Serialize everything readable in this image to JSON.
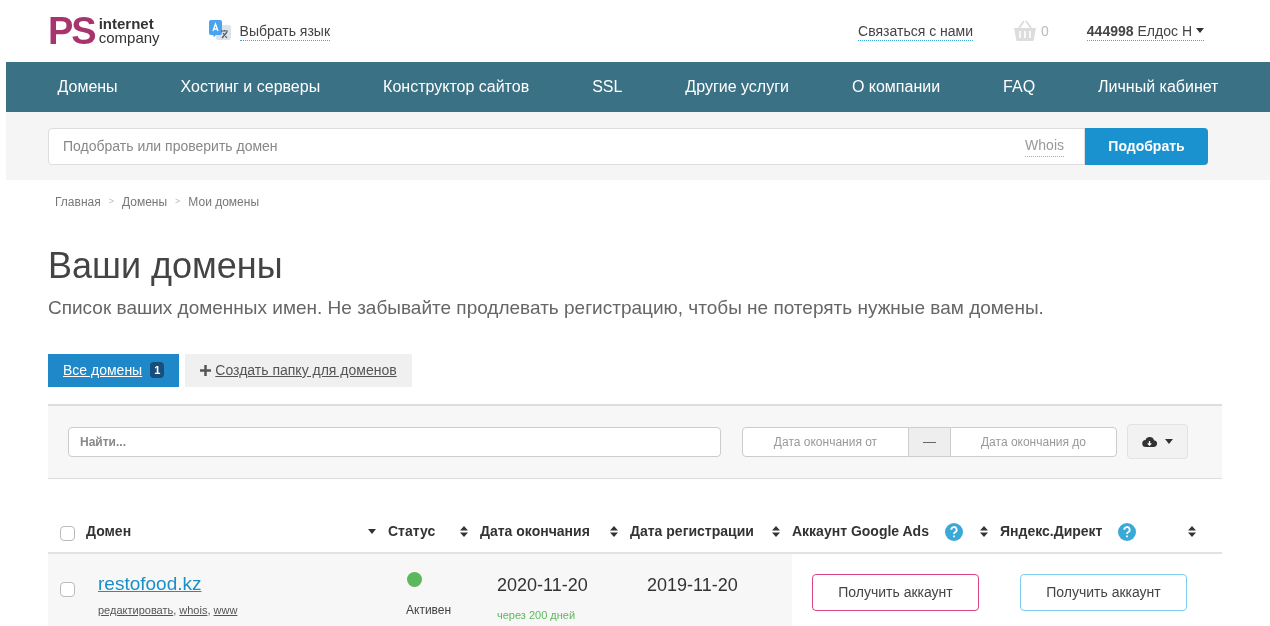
{
  "header": {
    "logo": {
      "mark": "PS",
      "line1": "internet",
      "line2": "company"
    },
    "language": "Выбрать язык",
    "contact": "Связаться с нами",
    "cart_count": "0",
    "account_id": "444998",
    "account_name": "Елдос Н"
  },
  "nav": [
    "Домены",
    "Хостинг и серверы",
    "Конструктор сайтов",
    "SSL",
    "Другие услуги",
    "О компании",
    "FAQ",
    "Личный кабинет"
  ],
  "domain_search": {
    "placeholder": "Подобрать или проверить домен",
    "whois": "Whois",
    "button": "Подобрать"
  },
  "breadcrumbs": [
    {
      "label": "Главная"
    },
    {
      "separator": ">",
      "label": "Домены"
    },
    {
      "separator": ">",
      "label": "Мои домены"
    }
  ],
  "title": "Ваши домены",
  "subtitle": "Список ваших доменных имен. Не забывайте продлевать регистрацию, чтобы не потерять нужные вам домены.",
  "tabs": [
    {
      "label": "Все домены",
      "count": "1",
      "selected": true,
      "kind": "folder"
    },
    {
      "label": "Создать папку для доменов",
      "selected": false,
      "kind": "create"
    }
  ],
  "filters": {
    "search_placeholder": "Найти...",
    "date_from_placeholder": "Дата окончания от",
    "separator": "—",
    "date_to_placeholder": "Дата окончания до"
  },
  "table": {
    "select_all_checked": false,
    "columns": [
      {
        "label": "Домен",
        "kind": "caret",
        "help": false
      },
      {
        "label": "Статус",
        "kind": "sortable",
        "help": false
      },
      {
        "label": "Дата окончания",
        "kind": "sortable",
        "help": false
      },
      {
        "label": "Дата регистрации",
        "kind": "sortable",
        "help": false
      },
      {
        "label": "Аккаунт Google Ads",
        "kind": "sortable",
        "help": true
      },
      {
        "label": "Яндекс.Директ",
        "kind": "sortable",
        "help": true
      }
    ],
    "rows": [
      {
        "checked": false,
        "domain": "restofood.kz",
        "links": [
          {
            "label": "редактировать",
            "separator": ","
          },
          {
            "label": "whois",
            "separator": ","
          },
          {
            "label": "www"
          }
        ],
        "status": {
          "label": "Активен",
          "color": "#5cb85c"
        },
        "expires": "2020-11-20",
        "expires_note": "через 200 дней",
        "registered": "2019-11-20",
        "actions": [
          {
            "label": "Получить аккаунт",
            "color": "#d9467f"
          },
          {
            "label": "Получить аккаунт",
            "color": "#7fd0ef"
          }
        ]
      }
    ]
  }
}
